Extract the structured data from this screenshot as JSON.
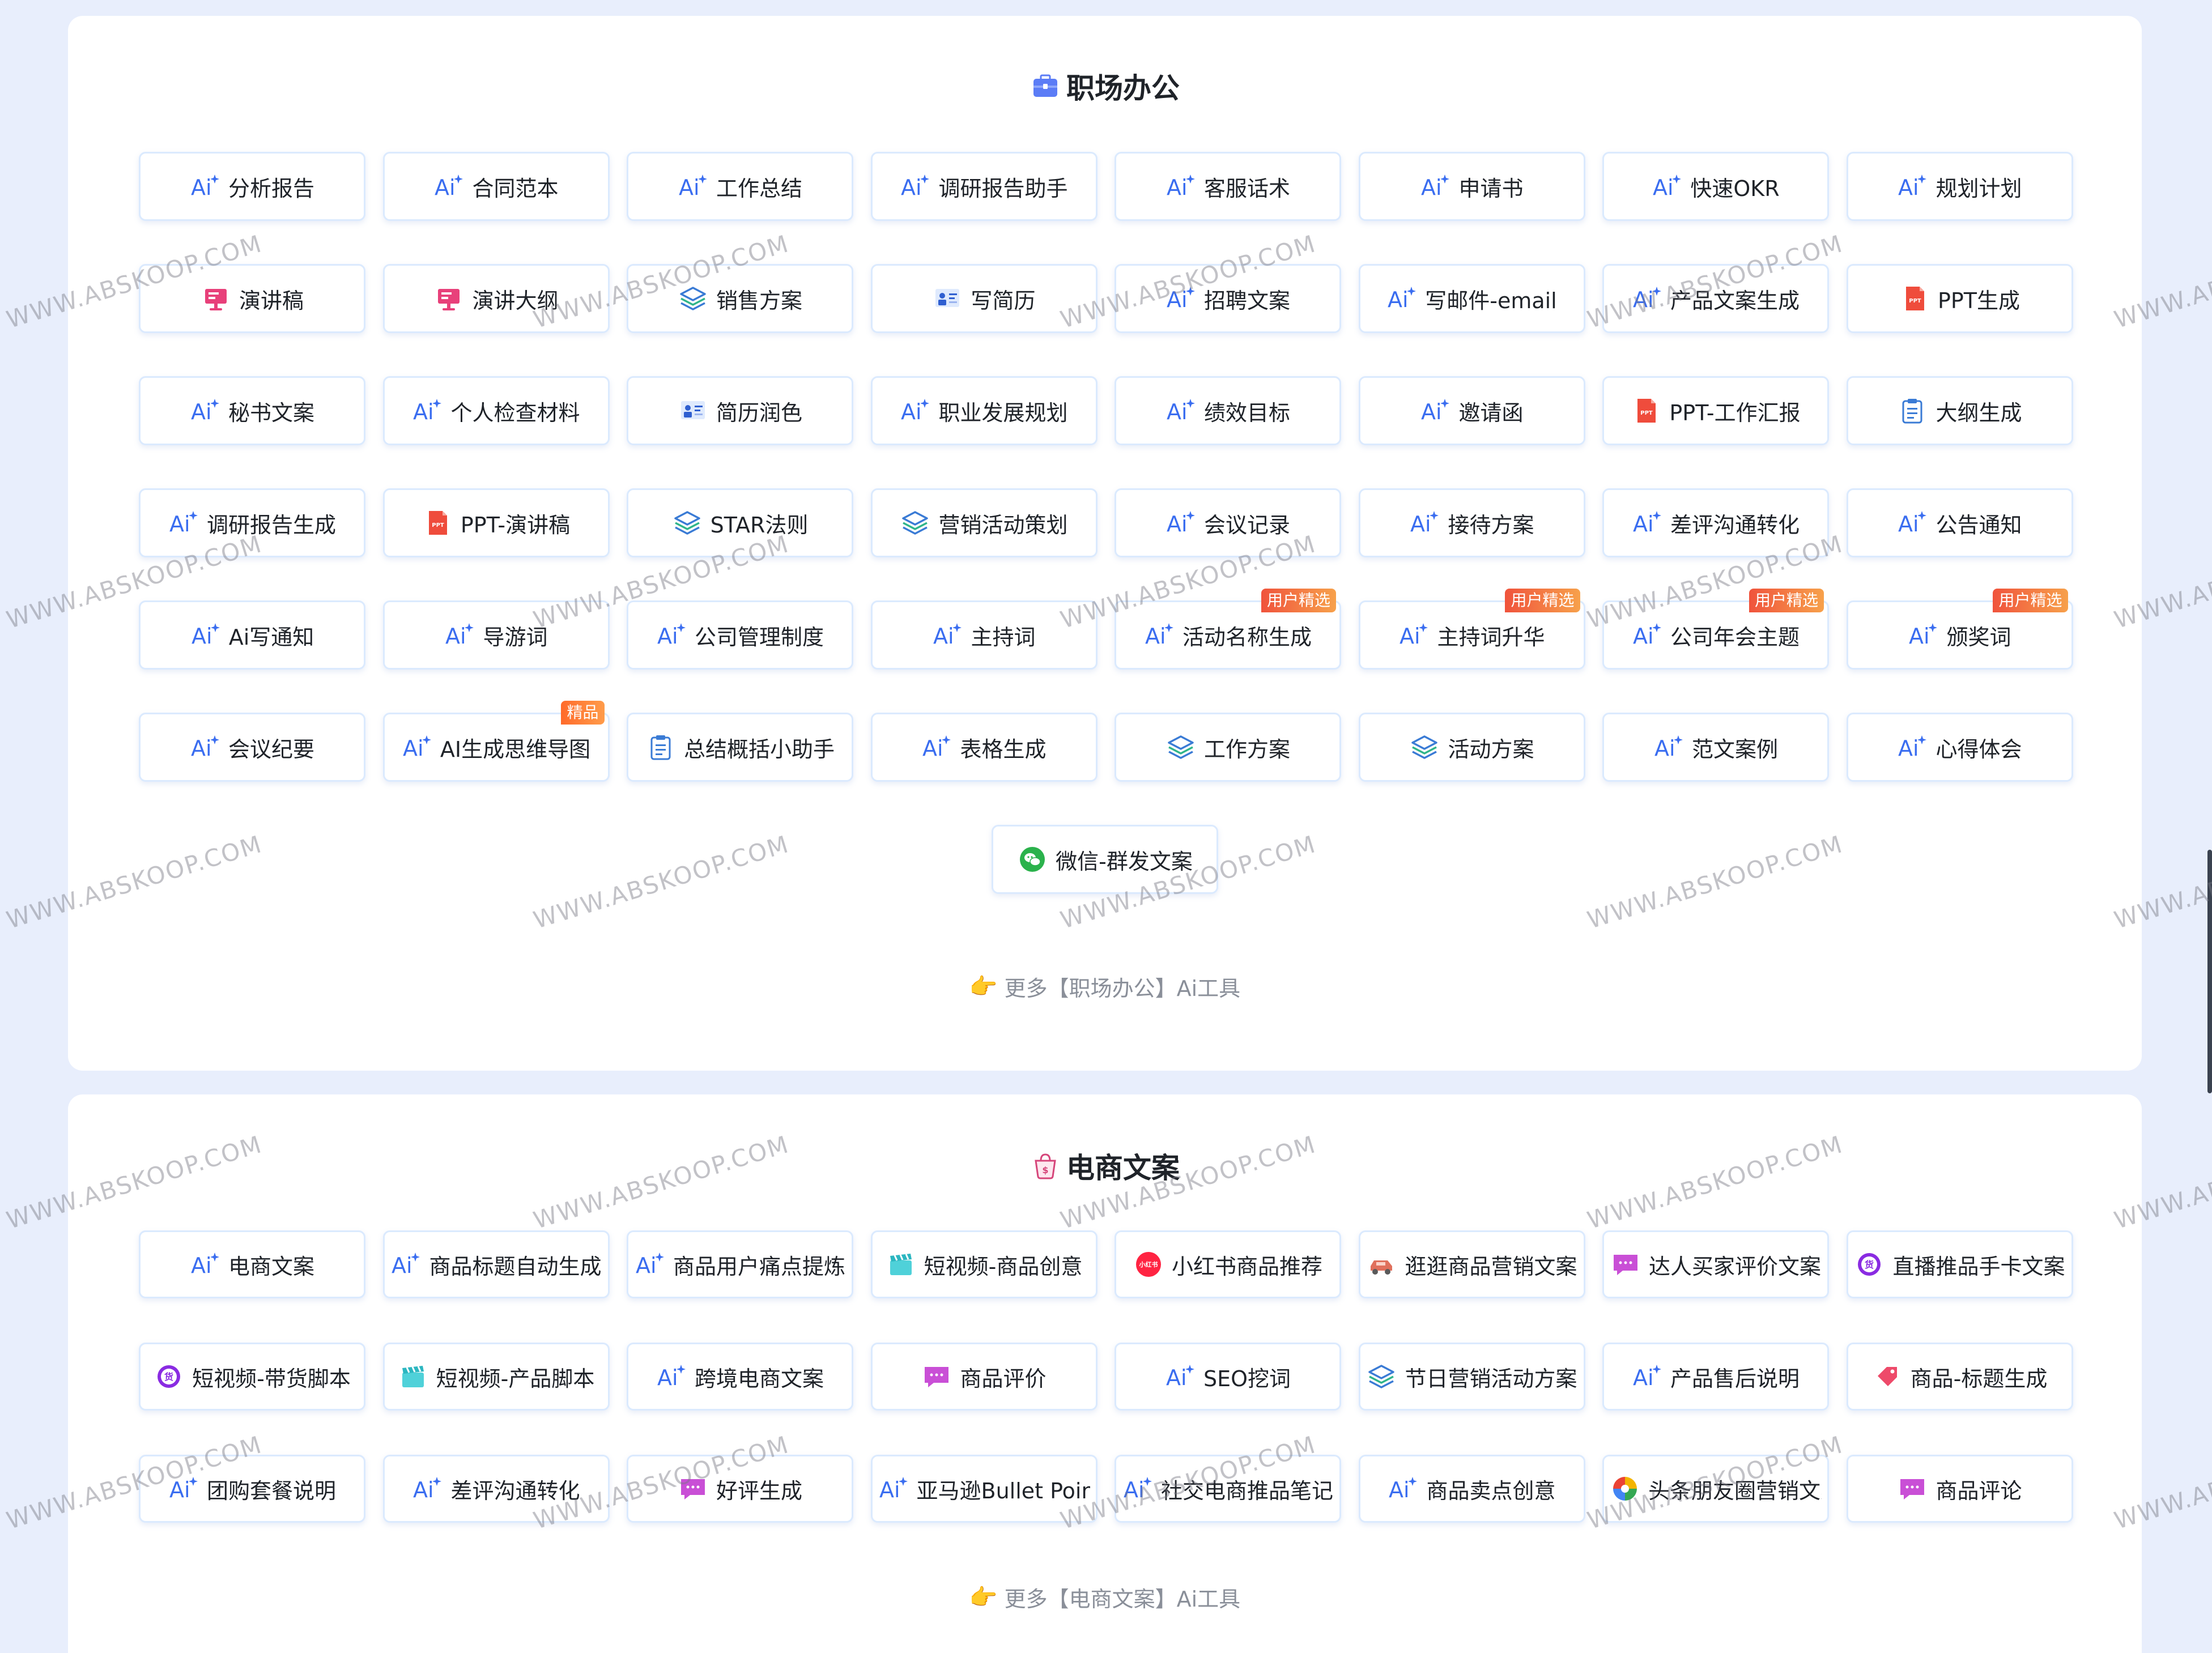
{
  "watermark_text": "WWW.ABSKOOP.COM",
  "sections": {
    "office": {
      "title": "职场办公",
      "more_label": "更多【职场办公】Ai工具",
      "tools": [
        {
          "label": "分析报告",
          "icon": "ai"
        },
        {
          "label": "合同范本",
          "icon": "ai"
        },
        {
          "label": "工作总结",
          "icon": "ai"
        },
        {
          "label": "调研报告助手",
          "icon": "ai"
        },
        {
          "label": "客服话术",
          "icon": "ai"
        },
        {
          "label": "申请书",
          "icon": "ai"
        },
        {
          "label": "快速OKR",
          "icon": "ai"
        },
        {
          "label": "规划计划",
          "icon": "ai"
        },
        {
          "label": "演讲稿",
          "icon": "speech"
        },
        {
          "label": "演讲大纲",
          "icon": "speech"
        },
        {
          "label": "销售方案",
          "icon": "layers"
        },
        {
          "label": "写简历",
          "icon": "resume"
        },
        {
          "label": "招聘文案",
          "icon": "ai"
        },
        {
          "label": "写邮件-email",
          "icon": "ai"
        },
        {
          "label": "产品文案生成",
          "icon": "ai"
        },
        {
          "label": "PPT生成",
          "icon": "ppt"
        },
        {
          "label": "秘书文案",
          "icon": "ai"
        },
        {
          "label": "个人检查材料",
          "icon": "ai"
        },
        {
          "label": "简历润色",
          "icon": "resume"
        },
        {
          "label": "职业发展规划",
          "icon": "ai"
        },
        {
          "label": "绩效目标",
          "icon": "ai"
        },
        {
          "label": "邀请函",
          "icon": "ai"
        },
        {
          "label": "PPT-工作汇报",
          "icon": "ppt"
        },
        {
          "label": "大纲生成",
          "icon": "clipboard"
        },
        {
          "label": "调研报告生成",
          "icon": "ai"
        },
        {
          "label": "PPT-演讲稿",
          "icon": "ppt"
        },
        {
          "label": "STAR法则",
          "icon": "layers"
        },
        {
          "label": "营销活动策划",
          "icon": "layers"
        },
        {
          "label": "会议记录",
          "icon": "ai"
        },
        {
          "label": "接待方案",
          "icon": "ai"
        },
        {
          "label": "差评沟通转化",
          "icon": "ai"
        },
        {
          "label": "公告通知",
          "icon": "ai"
        },
        {
          "label": "Ai写通知",
          "icon": "ai"
        },
        {
          "label": "导游词",
          "icon": "ai"
        },
        {
          "label": "公司管理制度",
          "icon": "ai"
        },
        {
          "label": "主持词",
          "icon": "ai"
        },
        {
          "label": "活动名称生成",
          "icon": "ai",
          "badge": "用户精选"
        },
        {
          "label": "主持词升华",
          "icon": "ai",
          "badge": "用户精选"
        },
        {
          "label": "公司年会主题",
          "icon": "ai",
          "badge": "用户精选"
        },
        {
          "label": "颁奖词",
          "icon": "ai",
          "badge": "用户精选"
        },
        {
          "label": "会议纪要",
          "icon": "ai"
        },
        {
          "label": "AI生成思维导图",
          "icon": "ai",
          "badge": "精品"
        },
        {
          "label": "总结概括小助手",
          "icon": "clipboard"
        },
        {
          "label": "表格生成",
          "icon": "ai"
        },
        {
          "label": "工作方案",
          "icon": "layers"
        },
        {
          "label": "活动方案",
          "icon": "layers"
        },
        {
          "label": "范文案例",
          "icon": "ai"
        },
        {
          "label": "心得体会",
          "icon": "ai"
        }
      ],
      "extra_tool": {
        "label": "微信-群发文案",
        "icon": "wechat"
      }
    },
    "ecommerce": {
      "title": "电商文案",
      "more_label": "更多【电商文案】Ai工具",
      "tools": [
        {
          "label": "电商文案",
          "icon": "ai"
        },
        {
          "label": "商品标题自动生成",
          "icon": "ai"
        },
        {
          "label": "商品用户痛点提炼",
          "icon": "ai"
        },
        {
          "label": "短视频-商品创意",
          "icon": "clapper"
        },
        {
          "label": "小红书商品推荐",
          "icon": "xhs"
        },
        {
          "label": "逛逛商品营销文案",
          "icon": "car"
        },
        {
          "label": "达人买家评价文案",
          "icon": "chat"
        },
        {
          "label": "直播推品手卡文案",
          "icon": "goods"
        },
        {
          "label": "短视频-带货脚本",
          "icon": "goods"
        },
        {
          "label": "短视频-产品脚本",
          "icon": "clapper"
        },
        {
          "label": "跨境电商文案",
          "icon": "ai"
        },
        {
          "label": "商品评价",
          "icon": "chat"
        },
        {
          "label": "SEO挖词",
          "icon": "ai"
        },
        {
          "label": "节日营销活动方案",
          "icon": "layers"
        },
        {
          "label": "产品售后说明",
          "icon": "ai"
        },
        {
          "label": "商品-标题生成",
          "icon": "tag"
        },
        {
          "label": "团购套餐说明",
          "icon": "ai"
        },
        {
          "label": "差评沟通转化",
          "icon": "ai"
        },
        {
          "label": "好评生成",
          "icon": "chat"
        },
        {
          "label": "亚马逊Bullet Points",
          "icon": "ai"
        },
        {
          "label": "社交电商推品笔记",
          "icon": "ai"
        },
        {
          "label": "商品卖点创意",
          "icon": "ai"
        },
        {
          "label": "头条朋友圈营销文案",
          "icon": "pinwheel"
        },
        {
          "label": "商品评论",
          "icon": "chat"
        }
      ]
    }
  },
  "colors": {
    "page_bg": "#e8eefc",
    "card_bg": "#ffffff",
    "tool_border": "#dbeafe",
    "ai_icon": "#3a6df0",
    "badge": "#f0533c"
  }
}
